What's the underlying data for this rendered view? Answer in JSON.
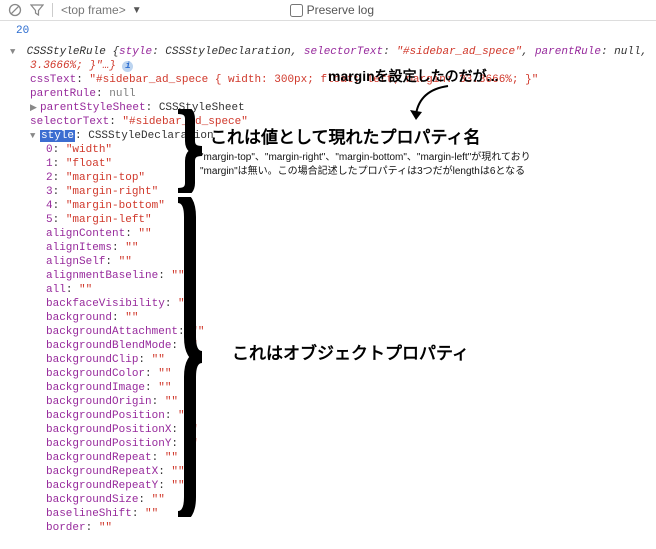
{
  "toolbar": {
    "frame": "<top frame>",
    "preserve_label": "Preserve log"
  },
  "count": "20",
  "rule": {
    "class": "CSSStyleRule",
    "summary_style_key": "style",
    "summary_style_val": "CSSStyleDeclaration",
    "summary_seltext_key": "selectorText",
    "summary_seltext_val": "\"#sidebar_ad_spece\"",
    "summary_parentrule_key": "parentRule",
    "summary_parentrule_val": "null",
    "summary_trail": "3.3666%; }\"…}",
    "cssText_key": "cssText",
    "cssText_val": "\"#sidebar_ad_spece { width: 300px; float: left; margin: 33.3666%; }\"",
    "parentRule_key": "parentRule",
    "parentRule_val": "null",
    "parentStyleSheet_key": "parentStyleSheet",
    "parentStyleSheet_val": "CSSStyleSheet",
    "selectorText_key": "selectorText",
    "selectorText_val": "\"#sidebar_ad_spece\"",
    "style_key": "style",
    "style_val": "CSSStyleDeclaration"
  },
  "indexed": [
    {
      "k": "0",
      "v": "\"width\""
    },
    {
      "k": "1",
      "v": "\"float\""
    },
    {
      "k": "2",
      "v": "\"margin-top\""
    },
    {
      "k": "3",
      "v": "\"margin-right\""
    },
    {
      "k": "4",
      "v": "\"margin-bottom\""
    },
    {
      "k": "5",
      "v": "\"margin-left\""
    }
  ],
  "props": [
    "alignContent",
    "alignItems",
    "alignSelf",
    "alignmentBaseline",
    "all",
    "backfaceVisibility",
    "background",
    "backgroundAttachment",
    "backgroundBlendMode",
    "backgroundClip",
    "backgroundColor",
    "backgroundImage",
    "backgroundOrigin",
    "backgroundPosition",
    "backgroundPositionX",
    "backgroundPositionY",
    "backgroundRepeat",
    "backgroundRepeatX",
    "backgroundRepeatY",
    "backgroundSize",
    "baselineShift",
    "border"
  ],
  "empty": "\"\"",
  "annot": {
    "margin_set": "marginを設定したのだが...",
    "values_label": "これは値として現れたプロパティ名",
    "values_note1": "\"margin-top\"、\"margin-right\"、\"margin-bottom\"、\"margin-left\"が現れており",
    "values_note2": "\"margin\"は無い。この場合記述したプロパティは3つだがlengthは6となる",
    "obj_label": "これはオブジェクトプロパティ"
  }
}
